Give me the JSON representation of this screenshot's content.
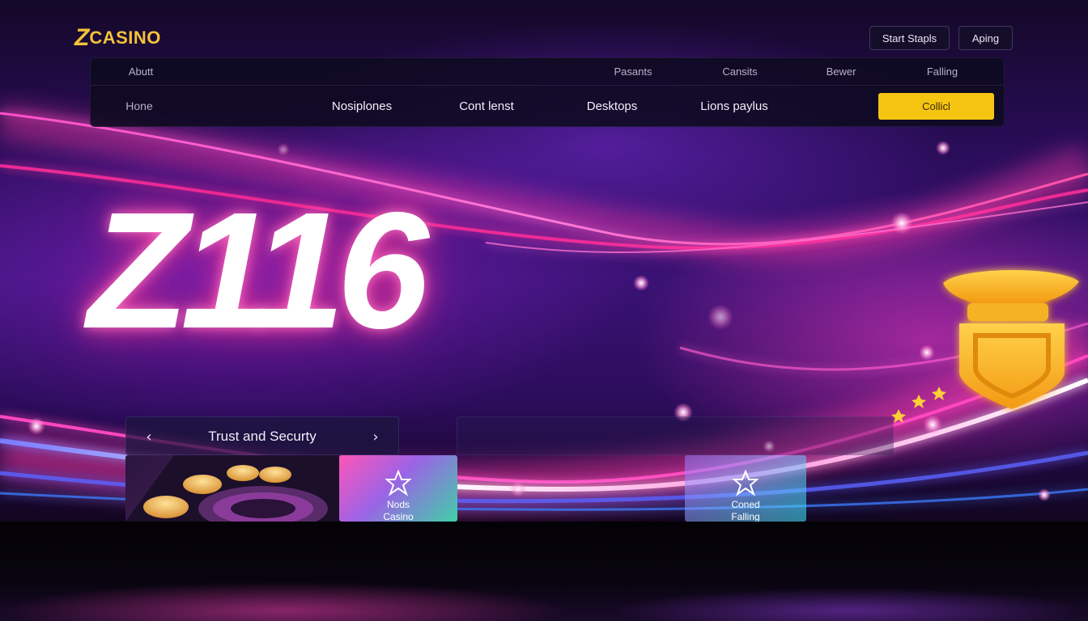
{
  "brand": {
    "mark": "Z",
    "name": "CASINO",
    "color": "#f4c23b"
  },
  "header_buttons": {
    "start": "Start Stapls",
    "aping": "Aping"
  },
  "nav": {
    "row1": [
      "Abutt",
      "Pasants",
      "Cansits",
      "Bewer",
      "Falling"
    ],
    "row2": [
      "Hone",
      "Nosiplones",
      "Cont lenst",
      "Desktops",
      "Lions paylus"
    ],
    "cta": "Collicl",
    "cta_color": "#f6c512"
  },
  "hero": {
    "title": "Z116"
  },
  "carousel": {
    "title": "Trust and Securty",
    "prev_icon": "‹",
    "next_icon": "›"
  },
  "cards": [
    {
      "id": "roulette",
      "icon": "roulette-chips-image",
      "label_1": "",
      "label_2": ""
    },
    {
      "id": "nods",
      "icon": "ornament-icon",
      "label_1": "Nods",
      "label_2": "Casino"
    },
    {
      "id": "coned",
      "icon": "ornament-icon",
      "label_1": "Coned",
      "label_2": "Falling"
    }
  ],
  "colors": {
    "background": "#2a0d5a",
    "glow_pink": "#ff3ca0",
    "accent_gold": "#f6c512"
  }
}
